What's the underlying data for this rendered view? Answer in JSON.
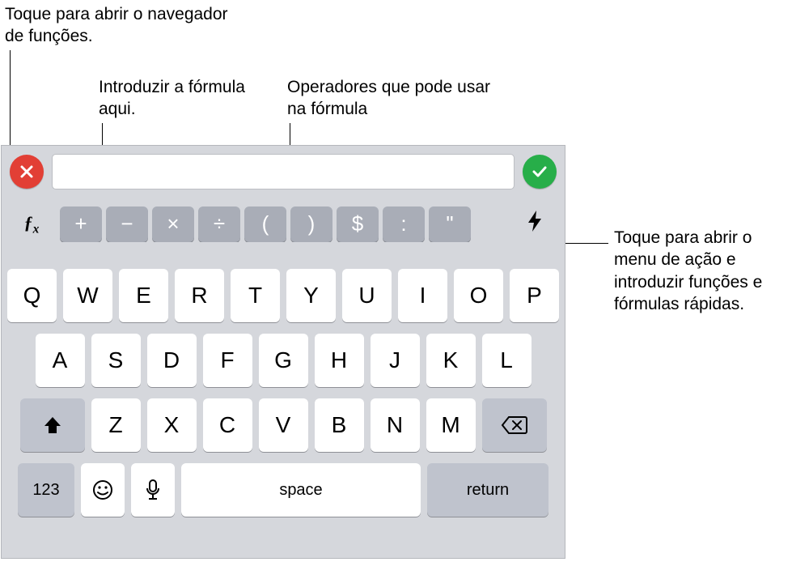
{
  "callouts": {
    "fx_label": "Toque para abrir o navegador de funções.",
    "formula_label": "Introduzir a fórmula aqui.",
    "operators_label": "Operadores que pode usar na fórmula",
    "action_label": "Toque para abrir o menu de ação e introduzir funções e fórmulas rápidas."
  },
  "formula_bar": {
    "value": "",
    "cancel_icon": "x-icon",
    "confirm_icon": "check-icon"
  },
  "fx_label": "ƒx",
  "lightning": "⚡︎",
  "operators": [
    "+",
    "−",
    "×",
    "÷",
    "(",
    ")",
    "$",
    ":",
    "\""
  ],
  "keys": {
    "row1": [
      "Q",
      "W",
      "E",
      "R",
      "T",
      "Y",
      "U",
      "I",
      "O",
      "P"
    ],
    "row2": [
      "A",
      "S",
      "D",
      "F",
      "G",
      "H",
      "J",
      "K",
      "L"
    ],
    "row3": [
      "Z",
      "X",
      "C",
      "V",
      "B",
      "N",
      "M"
    ],
    "shift": "⇧",
    "backspace": "⌫",
    "k123": "123",
    "emoji": "😀",
    "mic": "🎤",
    "space": "space",
    "return": "return"
  }
}
